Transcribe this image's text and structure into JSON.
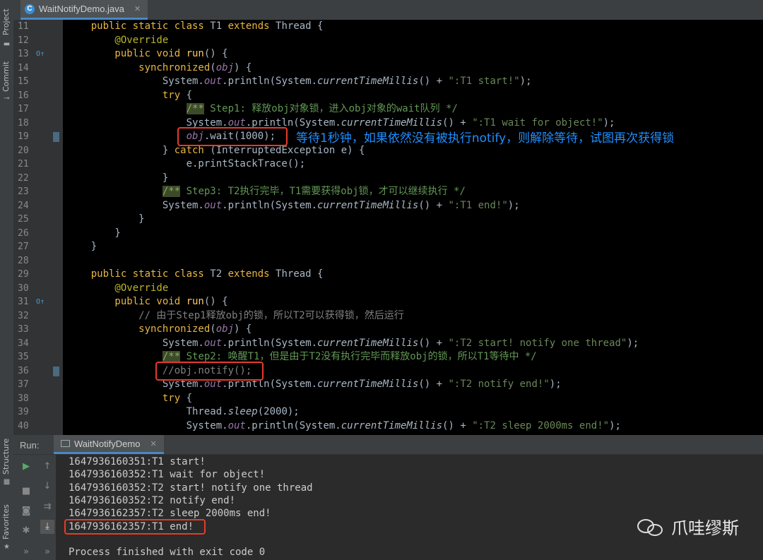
{
  "window": {
    "file_tab": "WaitNotifyDemo.java"
  },
  "tool_windows": {
    "project": "Project",
    "commit": "Commit",
    "structure": "Structure",
    "favorites": "Favorites"
  },
  "code": [
    {
      "n": "11",
      "tokens": [
        [
          "kw",
          "    public static class "
        ],
        [
          "cls",
          "T1 "
        ],
        [
          "kw",
          "extends "
        ],
        [
          "cls",
          "Thread {"
        ]
      ]
    },
    {
      "n": "12",
      "tokens": [
        [
          "ann",
          "        @Override"
        ]
      ]
    },
    {
      "n": "13",
      "tokens": [
        [
          "kw",
          "        public void "
        ],
        [
          "fn",
          "run"
        ],
        [
          "",
          "() {"
        ]
      ]
    },
    {
      "n": "14",
      "tokens": [
        [
          "kw",
          "            synchronized"
        ],
        [
          "",
          "("
        ],
        [
          "field",
          "obj"
        ],
        [
          "",
          ") {"
        ]
      ]
    },
    {
      "n": "15",
      "tokens": [
        [
          "",
          "                System."
        ],
        [
          "field",
          "out"
        ],
        [
          "",
          ".println(System."
        ],
        [
          "static",
          "currentTimeMillis"
        ],
        [
          "",
          "() + "
        ],
        [
          "str",
          "\":T1 start!\""
        ],
        [
          "",
          ");"
        ]
      ]
    },
    {
      "n": "16",
      "tokens": [
        [
          "kw",
          "                try "
        ],
        [
          "",
          "{"
        ]
      ]
    },
    {
      "n": "17",
      "tokens": [
        [
          "",
          "                    "
        ],
        [
          "docmark",
          "/**"
        ],
        [
          "doc",
          " Step1: 释放obj对象锁，进入obj对象的wait队列 */"
        ]
      ]
    },
    {
      "n": "18",
      "tokens": [
        [
          "",
          "                    System."
        ],
        [
          "field",
          "out"
        ],
        [
          "",
          ".println(System."
        ],
        [
          "static",
          "currentTimeMillis"
        ],
        [
          "",
          "() + "
        ],
        [
          "str",
          "\":T1 wait for object!\""
        ],
        [
          "",
          ");"
        ]
      ]
    },
    {
      "n": "19",
      "tokens": [
        [
          "",
          "                    "
        ],
        [
          "field",
          "obj"
        ],
        [
          "",
          ".wait(1000);"
        ]
      ]
    },
    {
      "n": "20",
      "tokens": [
        [
          "",
          "                } "
        ],
        [
          "kw",
          "catch "
        ],
        [
          "",
          "(InterruptedException e) {"
        ]
      ]
    },
    {
      "n": "21",
      "tokens": [
        [
          "",
          "                    e.printStackTrace();"
        ]
      ]
    },
    {
      "n": "22",
      "tokens": [
        [
          "",
          "                }"
        ]
      ]
    },
    {
      "n": "23",
      "tokens": [
        [
          "",
          "                "
        ],
        [
          "docmark",
          "/**"
        ],
        [
          "doc",
          " Step3: T2执行完毕，T1需要获得obj锁，才可以继续执行 */"
        ]
      ]
    },
    {
      "n": "24",
      "tokens": [
        [
          "",
          "                System."
        ],
        [
          "field",
          "out"
        ],
        [
          "",
          ".println(System."
        ],
        [
          "static",
          "currentTimeMillis"
        ],
        [
          "",
          "() + "
        ],
        [
          "str",
          "\":T1 end!\""
        ],
        [
          "",
          ");"
        ]
      ]
    },
    {
      "n": "25",
      "tokens": [
        [
          "",
          "            }"
        ]
      ]
    },
    {
      "n": "26",
      "tokens": [
        [
          "",
          "        }"
        ]
      ]
    },
    {
      "n": "27",
      "tokens": [
        [
          "",
          "    }"
        ]
      ]
    },
    {
      "n": "28",
      "tokens": []
    },
    {
      "n": "29",
      "tokens": [
        [
          "kw",
          "    public static class "
        ],
        [
          "cls",
          "T2 "
        ],
        [
          "kw",
          "extends "
        ],
        [
          "cls",
          "Thread {"
        ]
      ]
    },
    {
      "n": "30",
      "tokens": [
        [
          "ann",
          "        @Override"
        ]
      ]
    },
    {
      "n": "31",
      "tokens": [
        [
          "kw",
          "        public void "
        ],
        [
          "fn",
          "run"
        ],
        [
          "",
          "() {"
        ]
      ]
    },
    {
      "n": "32",
      "tokens": [
        [
          "cmt",
          "            // 由于Step1释放obj的锁，所以T2可以获得锁，然后运行"
        ]
      ]
    },
    {
      "n": "33",
      "tokens": [
        [
          "kw",
          "            synchronized"
        ],
        [
          "",
          "("
        ],
        [
          "field",
          "obj"
        ],
        [
          "",
          ") {"
        ]
      ]
    },
    {
      "n": "34",
      "tokens": [
        [
          "",
          "                System."
        ],
        [
          "field",
          "out"
        ],
        [
          "",
          ".println(System."
        ],
        [
          "static",
          "currentTimeMillis"
        ],
        [
          "",
          "() + "
        ],
        [
          "str",
          "\":T2 start! notify one thread\""
        ],
        [
          "",
          ");"
        ]
      ]
    },
    {
      "n": "35",
      "tokens": [
        [
          "",
          "                "
        ],
        [
          "docmark",
          "/**"
        ],
        [
          "doc",
          " Step2: 唤醒T1，但是由于T2没有执行完毕而释放obj的锁，所以T1等待中 */"
        ]
      ]
    },
    {
      "n": "36",
      "tokens": [
        [
          "cmt",
          "                //obj.notify();"
        ]
      ]
    },
    {
      "n": "37",
      "tokens": [
        [
          "",
          "                System."
        ],
        [
          "field",
          "out"
        ],
        [
          "",
          ".println(System."
        ],
        [
          "static",
          "currentTimeMillis"
        ],
        [
          "",
          "() + "
        ],
        [
          "str",
          "\":T2 notify end!\""
        ],
        [
          "",
          ");"
        ]
      ]
    },
    {
      "n": "38",
      "tokens": [
        [
          "kw",
          "                try "
        ],
        [
          "",
          "{"
        ]
      ]
    },
    {
      "n": "39",
      "tokens": [
        [
          "",
          "                    Thread."
        ],
        [
          "static",
          "sleep"
        ],
        [
          "",
          "(2000);"
        ]
      ]
    },
    {
      "n": "40",
      "tokens": [
        [
          "",
          "                    System."
        ],
        [
          "field",
          "out"
        ],
        [
          "",
          ".println(System."
        ],
        [
          "static",
          "currentTimeMillis"
        ],
        [
          "",
          "() + "
        ],
        [
          "str",
          "\":T2 sleep 2000ms end!\""
        ],
        [
          "",
          ");"
        ]
      ]
    }
  ],
  "annotation": "等待1秒钟，如果依然没有被执行notify，则解除等待，试图再次获得锁",
  "run": {
    "label": "Run:",
    "tab": "WaitNotifyDemo",
    "output": [
      "1647936160351:T1 start!",
      "1647936160352:T1 wait for object!",
      "1647936160352:T2 start! notify one thread",
      "1647936160352:T2 notify end!",
      "1647936162357:T2 sleep 2000ms end!",
      "1647936162357:T1 end!",
      "",
      "Process finished with exit code 0"
    ]
  },
  "watermark": "爪哇缪斯",
  "colors": {
    "keyword": "#e8b642",
    "string": "#6a8759",
    "doc_comment": "#629755",
    "highlight_box": "#e53b2c",
    "annotation_text": "#1f8fff"
  }
}
